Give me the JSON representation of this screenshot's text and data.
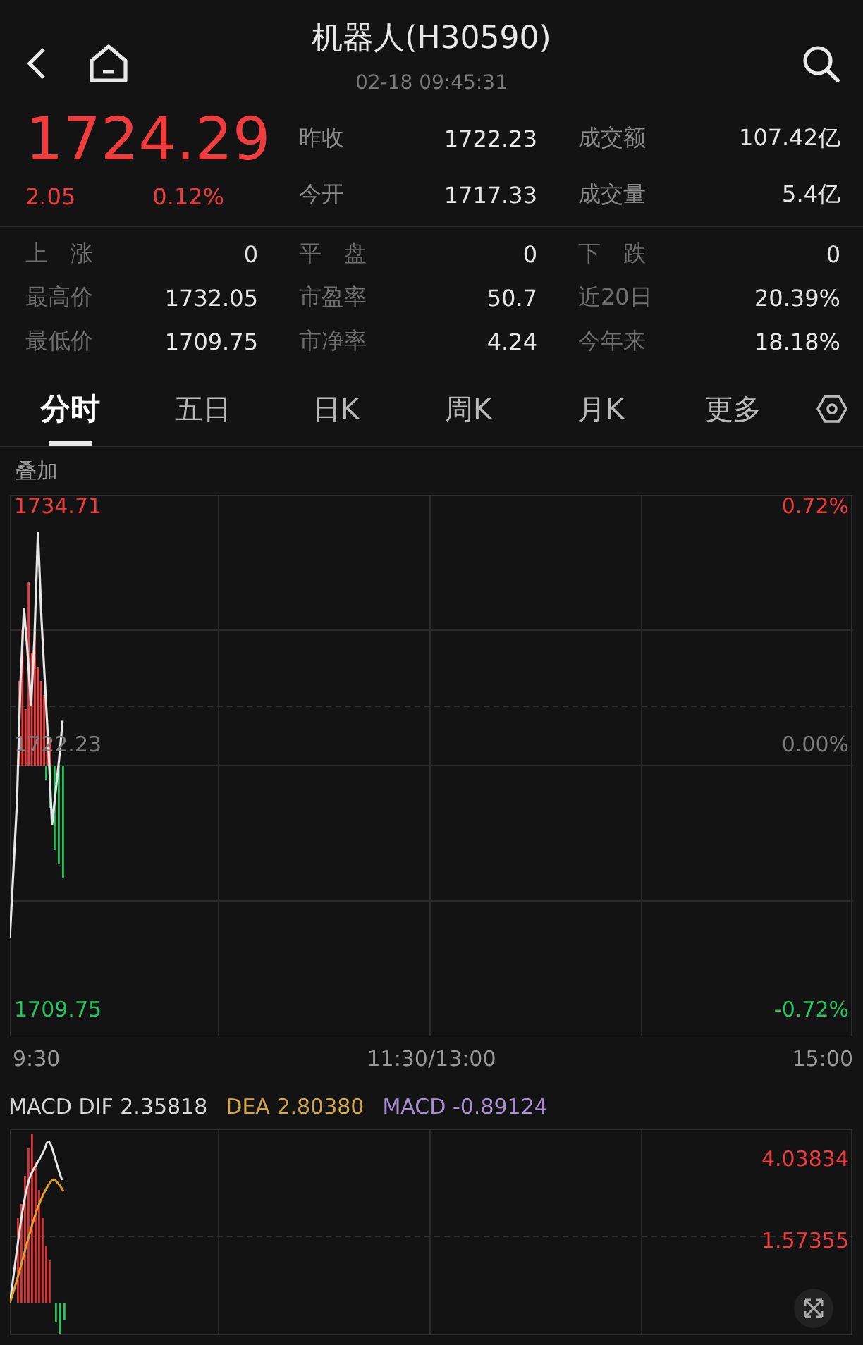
{
  "header": {
    "title": "机器人(H30590)",
    "time": "02-18 09:45:31"
  },
  "quote": {
    "price": "1724.29",
    "change": "2.05",
    "change_pct": "0.12%",
    "fields": [
      {
        "label": "昨收",
        "value": "1722.23"
      },
      {
        "label": "成交额",
        "value": "107.42亿"
      },
      {
        "label": "今开",
        "value": "1717.33"
      },
      {
        "label": "成交量",
        "value": "5.4亿"
      }
    ]
  },
  "stats": [
    {
      "label": "上　涨",
      "value": "0"
    },
    {
      "label": "平　盘",
      "value": "0"
    },
    {
      "label": "下　跌",
      "value": "0"
    },
    {
      "label": "最高价",
      "value": "1732.05"
    },
    {
      "label": "市盈率",
      "value": "50.7"
    },
    {
      "label": "近20日",
      "value": "20.39%"
    },
    {
      "label": "最低价",
      "value": "1709.75"
    },
    {
      "label": "市净率",
      "value": "4.24"
    },
    {
      "label": "今年来",
      "value": "18.18%"
    }
  ],
  "tabs": [
    {
      "label": "分时",
      "selected": true
    },
    {
      "label": "五日",
      "selected": false
    },
    {
      "label": "日K",
      "selected": false
    },
    {
      "label": "周K",
      "selected": false
    },
    {
      "label": "月K",
      "selected": false
    },
    {
      "label": "更多",
      "selected": false
    }
  ],
  "chart": {
    "overlay_label": "叠加",
    "left_labels": [
      "1734.71",
      "1722.23",
      "1709.75"
    ],
    "right_labels": [
      "0.72%",
      "0.00%",
      "-0.72%"
    ],
    "time_labels": [
      "9:30",
      "11:30/13:00",
      "15:00"
    ]
  },
  "macd": {
    "legend": [
      {
        "text": "MACD DIF 2.35818",
        "color": "#d8d8d8"
      },
      {
        "text": "DEA 2.80380",
        "color": "#d4a84a"
      },
      {
        "text": "MACD -0.89124",
        "color": "#a98fd6"
      }
    ],
    "axis_labels": [
      "4.03834",
      "1.57355"
    ]
  }
}
